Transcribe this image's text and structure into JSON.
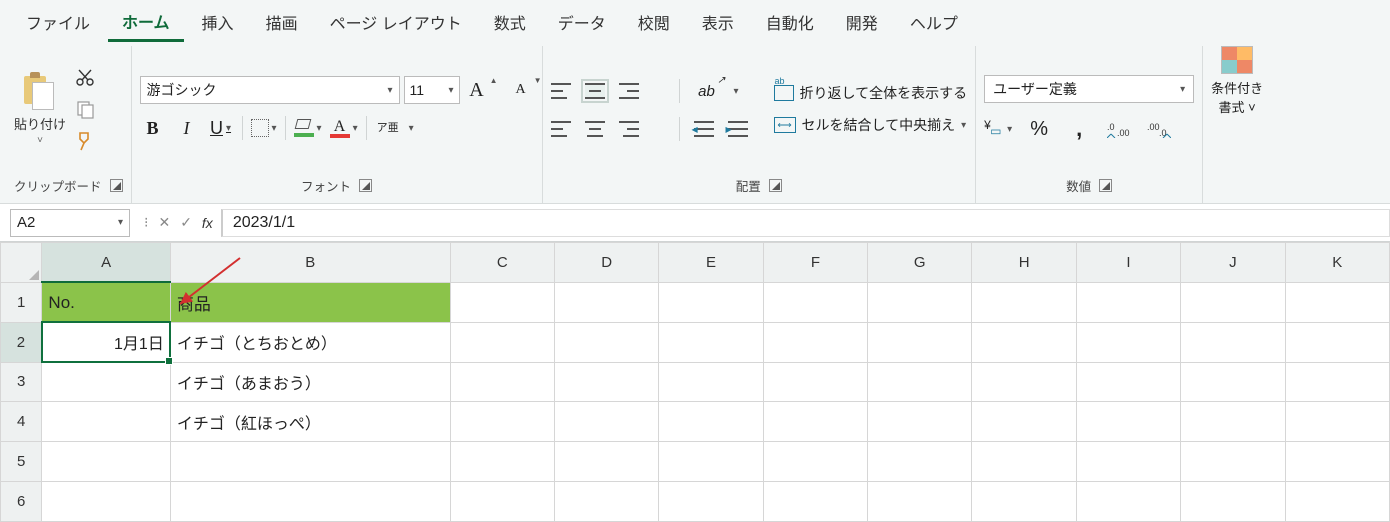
{
  "tabs": [
    "ファイル",
    "ホーム",
    "挿入",
    "描画",
    "ページ レイアウト",
    "数式",
    "データ",
    "校閲",
    "表示",
    "自動化",
    "開発",
    "ヘルプ"
  ],
  "active_tab_index": 1,
  "clipboard": {
    "paste": "貼り付け",
    "group": "クリップボード"
  },
  "font": {
    "name": "游ゴシック",
    "size": "11",
    "group": "フォント",
    "ruby_top": "ア",
    "ruby_bottom": "亜"
  },
  "alignment": {
    "group": "配置",
    "wrap": "折り返して全体を表示する",
    "merge": "セルを結合して中央揃え"
  },
  "number": {
    "group": "数値",
    "format": "ユーザー定義",
    "percent": "%",
    "comma": ","
  },
  "styles": {
    "cond_top": "条件付き",
    "cond_bottom": "書式 ˅"
  },
  "formula_bar": {
    "name_box": "A2",
    "formula": "2023/1/1",
    "fx": "fx"
  },
  "columns": [
    "A",
    "B",
    "C",
    "D",
    "E",
    "F",
    "G",
    "H",
    "I",
    "J",
    "K"
  ],
  "rows": [
    "1",
    "2",
    "3",
    "4",
    "5",
    "6"
  ],
  "selected_col": 0,
  "selected_row": 1,
  "cells": {
    "A1": "No.",
    "B1": "商品",
    "A2": "1月1日",
    "B2": "イチゴ（とちおとめ）",
    "B3": "イチゴ（あまおう）",
    "B4": "イチゴ（紅ほっぺ）"
  }
}
